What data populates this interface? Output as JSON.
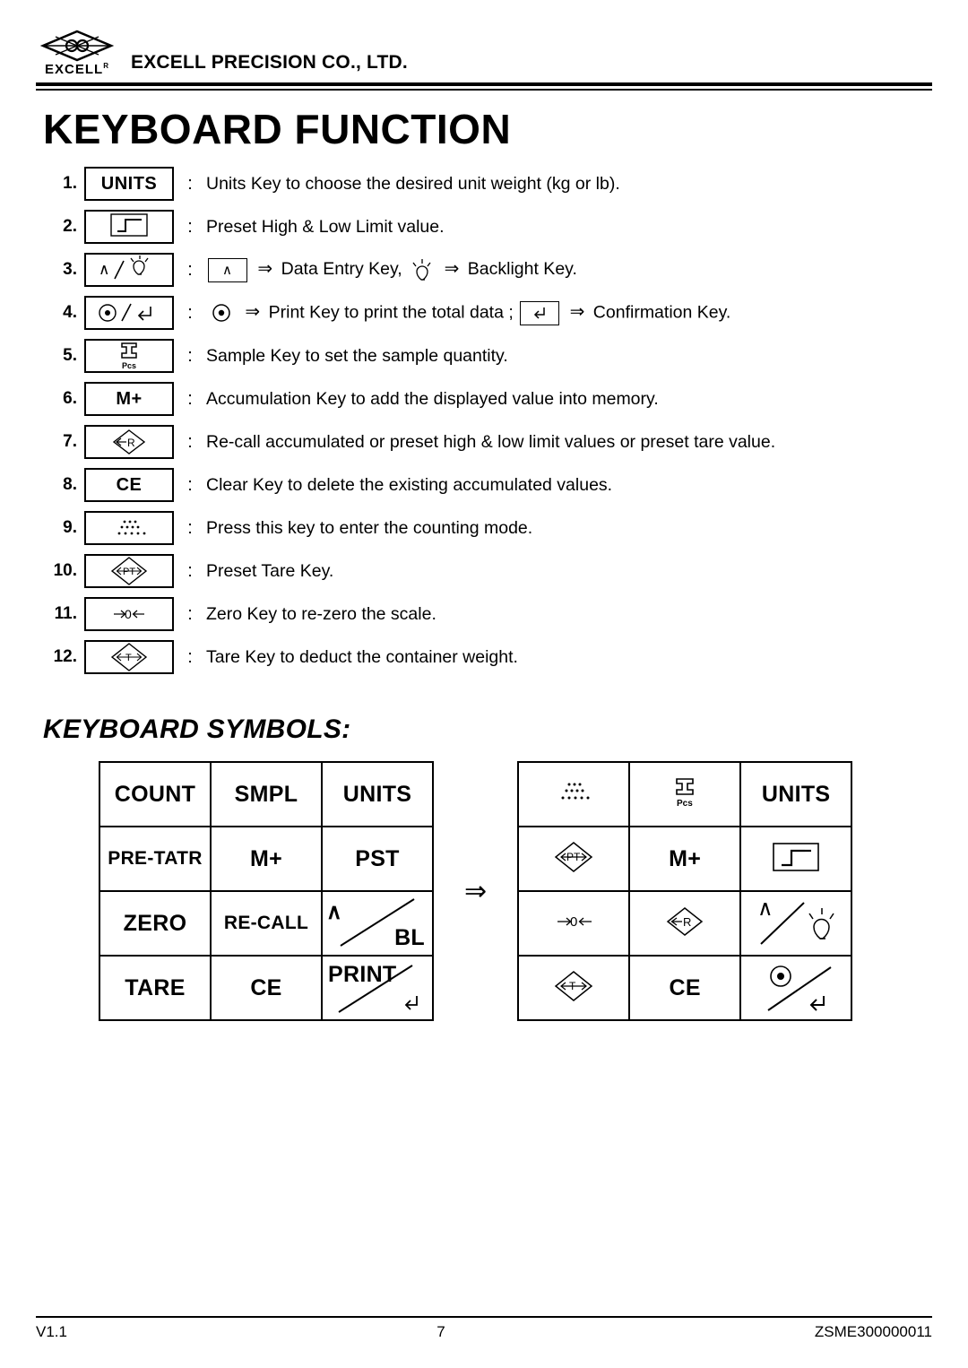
{
  "header": {
    "logo_word": "EXCELL",
    "logo_sup": "R",
    "company": "EXCELL PRECISION CO., LTD."
  },
  "title": "KEYBOARD FUNCTION",
  "functions": [
    {
      "num": "1.",
      "key_label": "UNITS",
      "key_type": "text",
      "colon": ":",
      "desc": "Units Key to choose the desired unit weight (kg or lb)."
    },
    {
      "num": "2.",
      "key_label": "",
      "key_type": "pst",
      "colon": ":",
      "desc": "Preset High & Low Limit value."
    },
    {
      "num": "3.",
      "key_label": "",
      "key_type": "entry-bl",
      "colon": ":",
      "desc": ""
    },
    {
      "num": "4.",
      "key_label": "",
      "key_type": "print-ent",
      "colon": ":",
      "desc": ""
    },
    {
      "num": "5.",
      "key_label": "Pcs",
      "key_type": "smpl",
      "colon": ":",
      "desc": "Sample Key to set the sample quantity."
    },
    {
      "num": "6.",
      "key_label": "M+",
      "key_type": "text",
      "colon": ":",
      "desc": "Accumulation Key to add the displayed value into memory."
    },
    {
      "num": "7.",
      "key_label": "R",
      "key_type": "recall",
      "colon": ":",
      "desc": "Re-call accumulated or preset high & low limit values or preset tare value."
    },
    {
      "num": "8.",
      "key_label": "CE",
      "key_type": "text",
      "colon": ":",
      "desc": "Clear Key to delete the existing accumulated values."
    },
    {
      "num": "9.",
      "key_label": "",
      "key_type": "count",
      "colon": ":",
      "desc": "Press this key to enter the counting mode."
    },
    {
      "num": "10.",
      "key_label": "PT",
      "key_type": "pretare",
      "colon": ":",
      "desc": "Preset Tare Key."
    },
    {
      "num": "11.",
      "key_label": "0",
      "key_type": "zero",
      "colon": ":",
      "desc": "Zero Key to re-zero the scale."
    },
    {
      "num": "12.",
      "key_label": "T",
      "key_type": "tare",
      "colon": ":",
      "desc": "Tare Key to deduct the container weight."
    }
  ],
  "inline": {
    "row3_a": "Data Entry Key,",
    "row3_b": "Backlight Key.",
    "row4_a": "Print Key to print the total data ;",
    "row4_b": "Confirmation Key.",
    "arrow": "⇒"
  },
  "section_title": "KEYBOARD SYMBOLS:",
  "symbols_left": [
    [
      "COUNT",
      "SMPL",
      "UNITS"
    ],
    [
      "PRE-TATR",
      "M+",
      "PST"
    ],
    [
      "ZERO",
      "RE-CALL",
      "BL"
    ],
    [
      "TARE",
      "CE",
      "PRINT"
    ]
  ],
  "symbols_right_labels": {
    "units": "UNITS",
    "mplus": "M+",
    "ce": "CE",
    "pcs": "Pcs",
    "pt": "PT",
    "zero": "0",
    "r": "R",
    "t": "T"
  },
  "transition_arrow": "⇒",
  "footer": {
    "version": "V1.1",
    "page": "7",
    "doc_id": "ZSME300000011"
  }
}
